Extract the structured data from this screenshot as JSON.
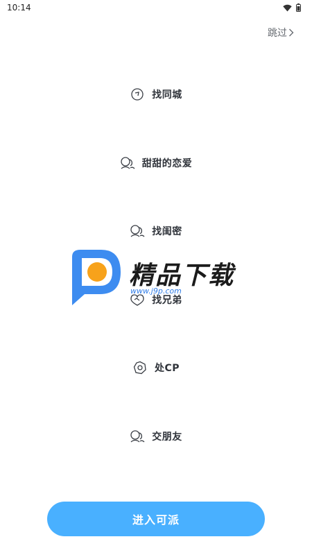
{
  "status_bar": {
    "time": "10:14",
    "icons": [
      "wifi-icon",
      "battery-icon"
    ]
  },
  "skip": {
    "label": "跳过",
    "icon": "chevron-right-icon"
  },
  "options": [
    {
      "label": "找同城",
      "icon": "compass-icon"
    },
    {
      "label": "甜甜的恋爱",
      "icon": "people-icon"
    },
    {
      "label": "找闺密",
      "icon": "people-icon"
    },
    {
      "label": "找兄弟",
      "icon": "handshake-icon"
    },
    {
      "label": "处CP",
      "icon": "gear-chat-icon"
    },
    {
      "label": "交朋友",
      "icon": "people-icon"
    }
  ],
  "watermark": {
    "title": "精品下载",
    "url": "www.j9p.com"
  },
  "enter_button": {
    "label": "进入可派"
  },
  "colors": {
    "accent": "#49b0ff",
    "text": "#2f333a",
    "muted": "#666a70",
    "background": "#ffffff"
  }
}
